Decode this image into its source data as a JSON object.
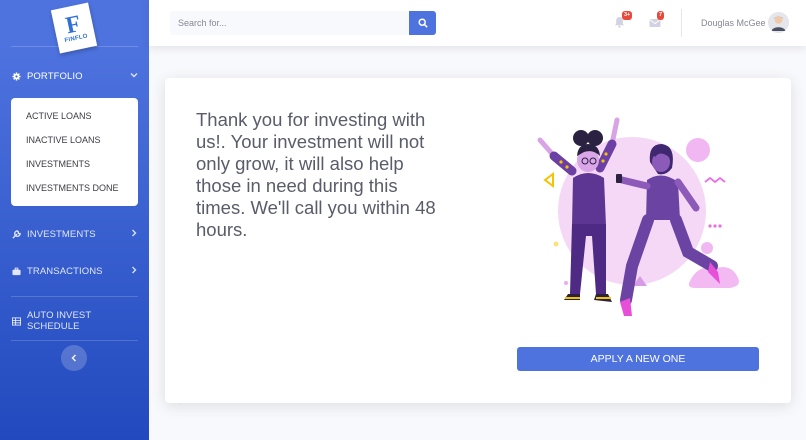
{
  "brand": {
    "logo_text": "FINFLO"
  },
  "sidebar": {
    "portfolio": {
      "label": "PORTFOLIO",
      "icon": "gear-icon"
    },
    "submenu": [
      "ACTIVE LOANS",
      "INACTIVE LOANS",
      "INVESTMENTS",
      "INVESTMENTS DONE"
    ],
    "investments": {
      "label": "INVESTMENTS",
      "icon": "wrench-icon"
    },
    "transactions": {
      "label": "TRANSACTIONS",
      "icon": "briefcase-icon"
    },
    "auto_invest": {
      "label": "AUTO INVEST SCHEDULE",
      "icon": "table-icon"
    }
  },
  "topbar": {
    "search_placeholder": "Search for...",
    "alerts_count": "3+",
    "messages_count": "7",
    "user_name": "Douglas McGee"
  },
  "main": {
    "message": "Thank you for investing with us!. Your investment will not only grow, it will also help those in need during this times. We'll call you within 48 hours.",
    "button_label": "APPLY A NEW ONE"
  },
  "colors": {
    "primary": "#4e73df",
    "danger": "#e74a3b",
    "text": "#5a5c69"
  }
}
